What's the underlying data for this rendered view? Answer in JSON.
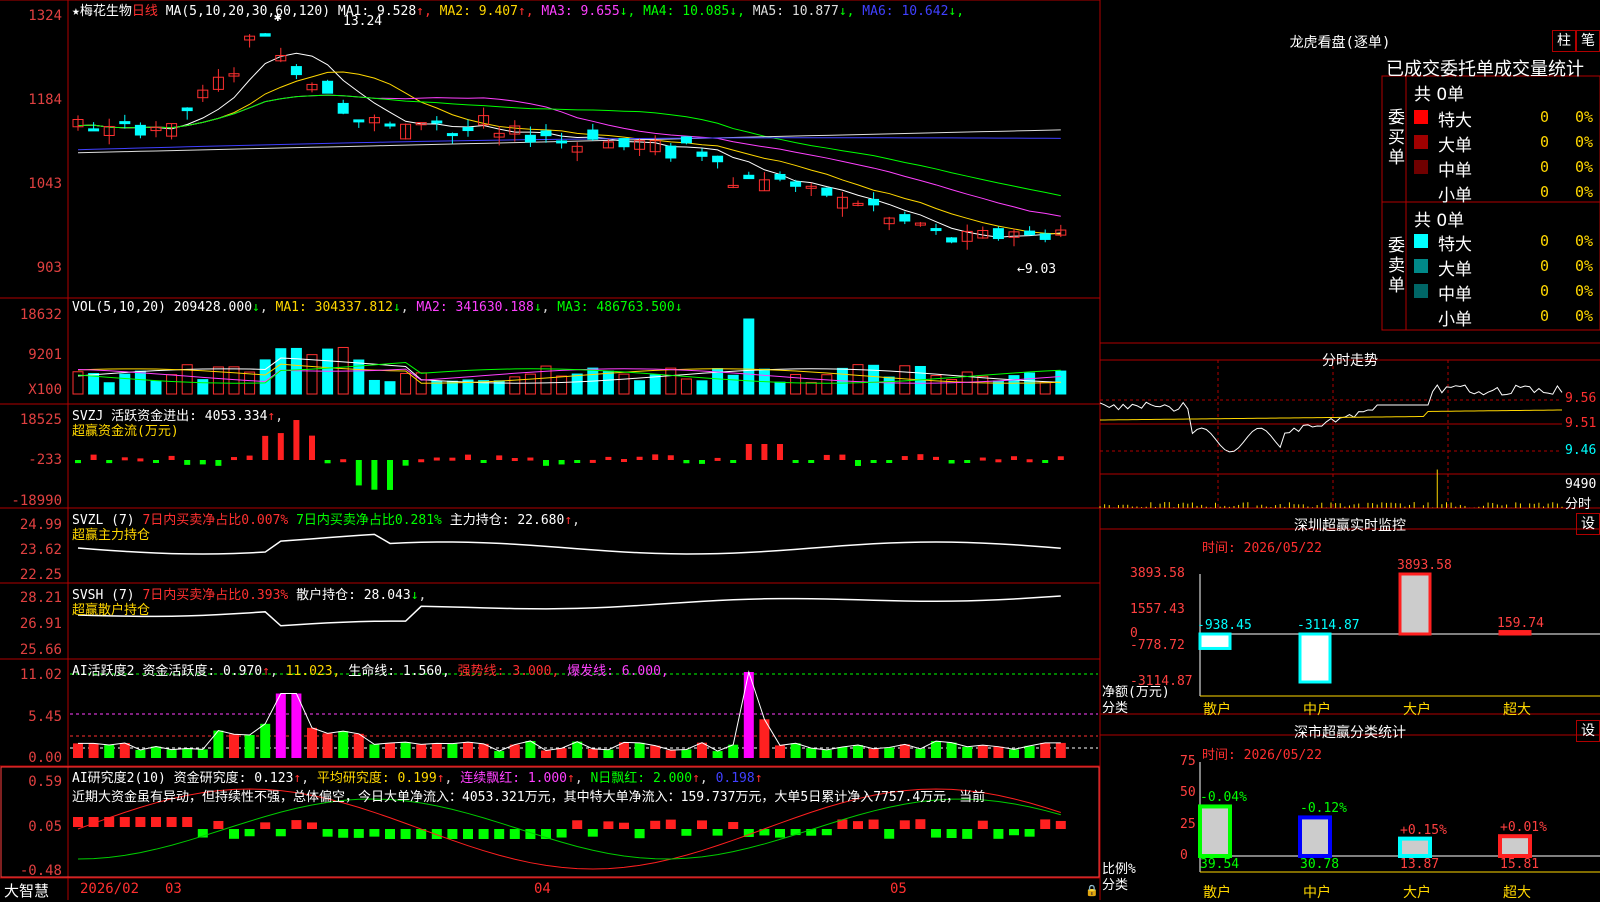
{
  "main_chart": {
    "stock_name": "梅花生物",
    "period": "日线",
    "ma_params": "MA(5,10,20,30,60,120)",
    "ma": [
      {
        "name": "MA1:",
        "value": "9.528",
        "arrow": "↑",
        "color": "#ffffff"
      },
      {
        "name": "MA2:",
        "value": "9.407",
        "arrow": "↑",
        "color": "#ffd700"
      },
      {
        "name": "MA3:",
        "value": "9.655",
        "arrow": "↓",
        "color": "#ff40ff"
      },
      {
        "name": "MA4:",
        "value": "10.085",
        "arrow": "↓",
        "color": "#00ff00"
      },
      {
        "name": "MA5:",
        "value": "10.877",
        "arrow": "↓",
        "color": "#dddddd"
      },
      {
        "name": "MA6:",
        "value": "10.642",
        "arrow": "↓",
        "color": "#4040ff"
      }
    ],
    "high_marker": "13.24",
    "low_marker": "←9.03",
    "y_ticks": [
      "1324",
      "1184",
      "1043",
      "903"
    ]
  },
  "volume": {
    "label": "VOL(5,10,20)",
    "value": "209428.000",
    "ma1": "MA1: 304337.812",
    "ma2": "MA2: 341630.188",
    "ma3": "MA3: 486763.500",
    "y_ticks": [
      "18632",
      "9201",
      "X100"
    ]
  },
  "svzj": {
    "label": "SVZJ",
    "line1": "活跃资金进出: 4053.334",
    "line2": "超赢资金流(万元)",
    "y_ticks": [
      "18525",
      "-233",
      "-18990"
    ]
  },
  "svzl": {
    "label": "SVZL (7)",
    "t1": "7日内买卖净占比0.007%",
    "t2": "7日内买卖净占比0.281%",
    "t3": "主力持仓: 22.680",
    "line2": "超赢主力持仓",
    "y_ticks": [
      "24.99",
      "23.62",
      "22.25"
    ]
  },
  "svsh": {
    "label": "SVSH (7)",
    "t1": "7日内买卖净占比0.393%",
    "t2": "散户持仓: 28.043",
    "line2": "超赢散户持仓",
    "y_ticks": [
      "28.21",
      "26.91",
      "25.66"
    ]
  },
  "ai_active": {
    "label": "AI活跃度2",
    "t1": "资金活跃度: 0.970",
    "t2": "11.023,",
    "t3": "生命线: 1.560,",
    "t4": "强势线: 3.000,",
    "t5": "爆发线: 6.000,",
    "y_ticks": [
      "11.02",
      "5.45",
      "0.00"
    ]
  },
  "ai_research": {
    "label": "AI研究度2(10)",
    "t1": "资金研究度: 0.123",
    "t2": "平均研究度: 0.199",
    "t3": "连续飘红: 1.000",
    "t4": "N日飘红: 2.000",
    "t5": "0.198",
    "comment": "近期大资金虽有异动，但持续性不强，总体偏空，今日大单净流入：4053.321万元，其中特大单净流入：159.737万元，大单5日累计净入7757.4万元，当前",
    "y_ticks": [
      "0.59",
      "0.05",
      "-0.48"
    ]
  },
  "bottom_axis": {
    "brand": "大智慧",
    "dates": [
      "2026/02",
      "03",
      "04",
      "05"
    ]
  },
  "right_panel": {
    "dragon_title": "龙虎看盘(逐单)",
    "btn_bar": "柱",
    "btn_stroke": "笔",
    "stats_title": "已成交委托单成交量统计",
    "buy_label": "委买单",
    "sell_label": "委卖单",
    "buy_total": "共 0单",
    "sell_total": "共 0单",
    "buy_rows": [
      {
        "name": "特大",
        "count": "0",
        "pct": "0%",
        "color": "#ff0000"
      },
      {
        "name": "大单",
        "count": "0",
        "pct": "0%",
        "color": "#a00000"
      },
      {
        "name": "中单",
        "count": "0",
        "pct": "0%",
        "color": "#700000"
      },
      {
        "name": "小单",
        "count": "0",
        "pct": "0%",
        "color": "#000000"
      }
    ],
    "sell_rows": [
      {
        "name": "特大",
        "count": "0",
        "pct": "0%",
        "color": "#00ffff"
      },
      {
        "name": "大单",
        "count": "0",
        "pct": "0%",
        "color": "#008888"
      },
      {
        "name": "中单",
        "count": "0",
        "pct": "0%",
        "color": "#006666"
      },
      {
        "name": "小单",
        "count": "0",
        "pct": "0%",
        "color": "#000000"
      }
    ],
    "intraday_title": "分时走势",
    "intraday_ticks": [
      "9.56",
      "9.51",
      "9.46"
    ],
    "intraday_vol": "9490",
    "intraday_vol_label": "分时",
    "sz_monitor_title": "深圳超赢实时监控",
    "sz_monitor_time": "时间: 2026/05/22",
    "monitor_ticks": [
      "3893.58",
      "1557.43",
      "0",
      "-778.72",
      "-3114.87"
    ],
    "monitor_ylabel1": "净额(万元)",
    "monitor_ylabel2": "分类",
    "monitor_bars": [
      {
        "cat": "散户",
        "value": -938.45,
        "label": "-938.45"
      },
      {
        "cat": "中户",
        "value": -3114.87,
        "label": "-3114.87"
      },
      {
        "cat": "大户",
        "value": 3893.58,
        "label": "3893.58"
      },
      {
        "cat": "超大",
        "value": 159.74,
        "label": "159.74"
      }
    ],
    "sz_class_title": "深市超赢分类统计",
    "sz_class_time": "时间: 2026/05/22",
    "class_ticks": [
      "75",
      "50",
      "25",
      "0"
    ],
    "class_ylabel1": "比例%",
    "class_ylabel2": "分类",
    "class_bars": [
      {
        "cat": "散户",
        "value": 39.54,
        "label": "39.54",
        "delta": "-0.04%"
      },
      {
        "cat": "中户",
        "value": 30.78,
        "label": "30.78",
        "delta": "-0.12%"
      },
      {
        "cat": "大户",
        "value": 13.87,
        "label": "13.87",
        "delta": "+0.15%"
      },
      {
        "cat": "超大",
        "value": 15.81,
        "label": "15.81",
        "delta": "+0.01%"
      }
    ],
    "set_btn": "设"
  }
}
